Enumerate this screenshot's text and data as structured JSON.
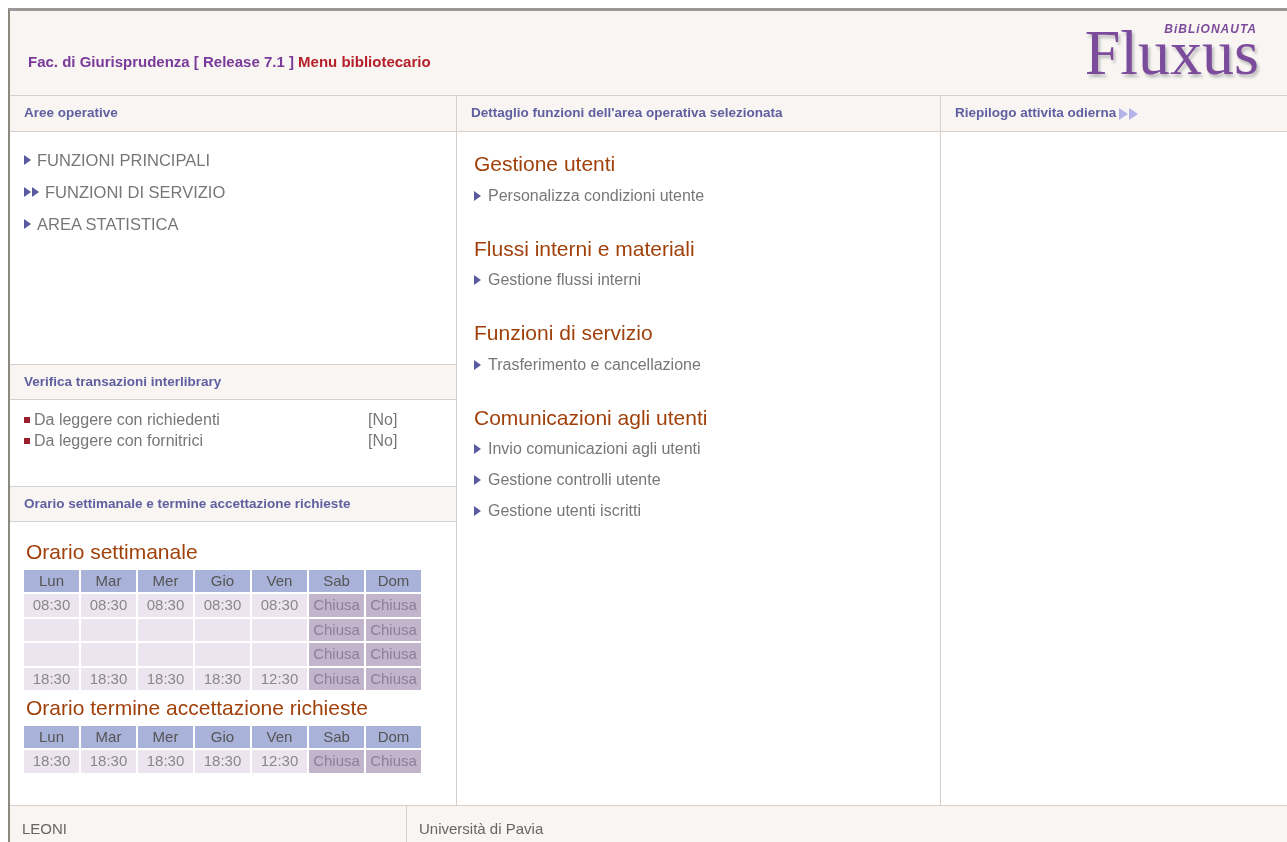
{
  "header": {
    "title": "Fac. di Giurisprudenza [ Release 7.1 ]",
    "menu": "Menu bibliotecario",
    "logo_small": "BiBLiONAUTA",
    "logo": "Fluxus"
  },
  "left": {
    "heading": "Aree operative",
    "items": [
      {
        "label": "FUNZIONI PRINCIPALI",
        "selected": false
      },
      {
        "label": "FUNZIONI DI SERVIZIO",
        "selected": true
      },
      {
        "label": "AREA STATISTICA",
        "selected": false
      }
    ],
    "interlibrary": {
      "heading": "Verifica transazioni interlibrary",
      "rows": [
        {
          "label": "Da leggere con richiedenti",
          "value": "[No]"
        },
        {
          "label": "Da leggere con fornitrici",
          "value": "[No]"
        }
      ]
    },
    "schedule": {
      "heading": "Orario settimanale e termine accettazione richieste",
      "tables": [
        {
          "title": "Orario settimanale",
          "days": [
            "Lun",
            "Mar",
            "Mer",
            "Gio",
            "Ven",
            "Sab",
            "Dom"
          ],
          "rows": [
            {
              "cells": [
                {
                  "text": "08:30",
                  "closed": false
                },
                {
                  "text": "08:30",
                  "closed": false
                },
                {
                  "text": "08:30",
                  "closed": false
                },
                {
                  "text": "08:30",
                  "closed": false
                },
                {
                  "text": "08:30",
                  "closed": false
                },
                {
                  "text": "Chiusa",
                  "closed": true
                },
                {
                  "text": "Chiusa",
                  "closed": true
                }
              ]
            },
            {
              "cells": [
                {
                  "closed": false
                },
                {
                  "closed": false
                },
                {
                  "closed": false
                },
                {
                  "closed": false
                },
                {
                  "closed": false
                },
                {
                  "text": "Chiusa",
                  "closed": true
                },
                {
                  "text": "Chiusa",
                  "closed": true
                }
              ]
            },
            {
              "cells": [
                {
                  "closed": false
                },
                {
                  "closed": false
                },
                {
                  "closed": false
                },
                {
                  "closed": false
                },
                {
                  "closed": false
                },
                {
                  "text": "Chiusa",
                  "closed": true
                },
                {
                  "text": "Chiusa",
                  "closed": true
                }
              ]
            },
            {
              "cells": [
                {
                  "text": "18:30",
                  "closed": false
                },
                {
                  "text": "18:30",
                  "closed": false
                },
                {
                  "text": "18:30",
                  "closed": false
                },
                {
                  "text": "18:30",
                  "closed": false
                },
                {
                  "text": "12:30",
                  "closed": false
                },
                {
                  "text": "Chiusa",
                  "closed": true
                },
                {
                  "text": "Chiusa",
                  "closed": true
                }
              ]
            }
          ]
        },
        {
          "title": "Orario termine accettazione richieste",
          "days": [
            "Lun",
            "Mar",
            "Mer",
            "Gio",
            "Ven",
            "Sab",
            "Dom"
          ],
          "rows": [
            {
              "cells": [
                {
                  "text": "18:30",
                  "closed": false
                },
                {
                  "text": "18:30",
                  "closed": false
                },
                {
                  "text": "18:30",
                  "closed": false
                },
                {
                  "text": "18:30",
                  "closed": false
                },
                {
                  "text": "12:30",
                  "closed": false
                },
                {
                  "text": "Chiusa",
                  "closed": true
                },
                {
                  "text": "Chiusa",
                  "closed": true
                }
              ]
            }
          ]
        }
      ]
    }
  },
  "middle": {
    "heading": "Dettaglio funzioni dell'area operativa selezionata",
    "groups": [
      {
        "title": "Gestione utenti",
        "links": [
          "Personalizza condizioni utente"
        ]
      },
      {
        "title": "Flussi interni e materiali",
        "links": [
          "Gestione flussi interni"
        ]
      },
      {
        "title": "Funzioni di servizio",
        "links": [
          "Trasferimento e cancellazione"
        ]
      },
      {
        "title": "Comunicazioni agli utenti",
        "links": [
          "Invio comunicazioni agli utenti",
          "Gestione controlli utente",
          "Gestione utenti iscritti"
        ]
      }
    ]
  },
  "right": {
    "heading": "Riepilogo attivita odierna"
  },
  "footer": {
    "user": "LEONI",
    "institution": "Università di Pavia"
  }
}
